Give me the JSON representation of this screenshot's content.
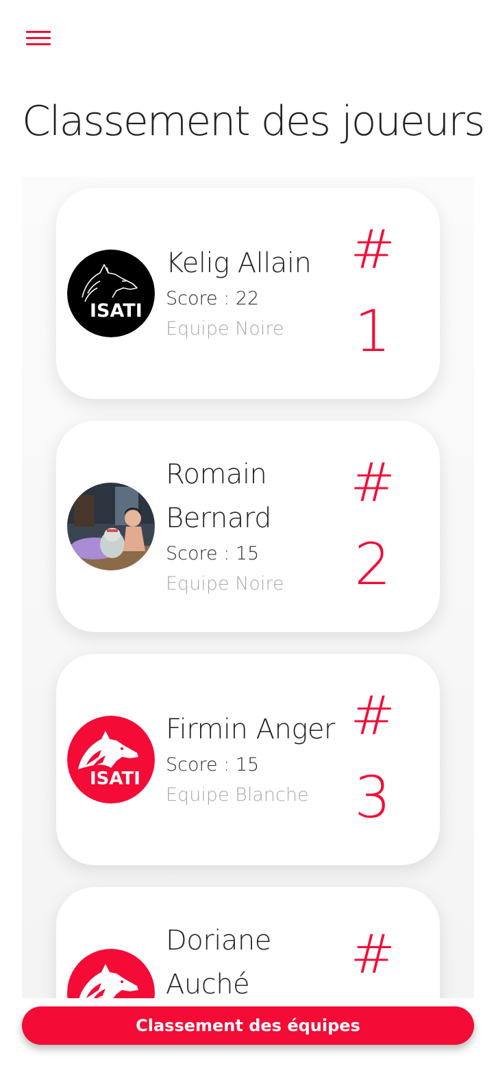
{
  "header": {
    "menu_icon": "hamburger-menu-icon",
    "title": "Classement des joueurs"
  },
  "colors": {
    "accent": "#f40b36",
    "text": "#222222",
    "muted": "#a9a9a9",
    "team_black_logo_bg": "#000000",
    "team_white_logo_bg": "#f40b36"
  },
  "players": [
    {
      "name": "Kelig Allain",
      "score": "Score : 22",
      "team": "Equipe Noire",
      "rank_hash": "#",
      "rank": "1",
      "avatar": "isati-wolf-logo-black"
    },
    {
      "name": "Romain Bernard",
      "score": "Score : 15",
      "team": "Equipe Noire",
      "rank_hash": "#",
      "rank": "2",
      "avatar": "profile-photo"
    },
    {
      "name": "Firmin Anger",
      "score": "Score : 15",
      "team": "Equipe Blanche",
      "rank_hash": "#",
      "rank": "3",
      "avatar": "isati-wolf-logo-red"
    },
    {
      "name": "Doriane Auché",
      "rank_hash": "#",
      "avatar": "isati-wolf-logo-red"
    }
  ],
  "footer": {
    "teams_button_label": "Classement des équipes"
  }
}
